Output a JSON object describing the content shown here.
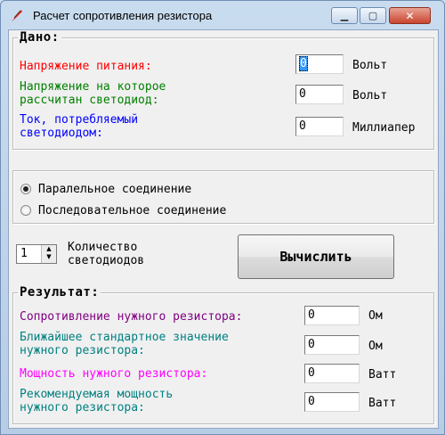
{
  "window": {
    "title": "Расчет сопротивления резистора"
  },
  "given": {
    "legend": "Дано:",
    "rows": [
      {
        "label": "Напряжение питания:",
        "value": "0",
        "unit": "Вольт"
      },
      {
        "label": "Напряжение на которое\nрассчитан светодиод:",
        "value": "0",
        "unit": "Вольт"
      },
      {
        "label": "Ток, потребляемый\nсветодиодом:",
        "value": "0",
        "unit": "Миллиапер"
      }
    ]
  },
  "connection": {
    "parallel_label": "Паралельное соединение",
    "serial_label": "Последовательное соединение",
    "selected": "parallel"
  },
  "count": {
    "value": "1",
    "label": "Количество\nсветодиодов"
  },
  "calculate_label": "Вычислить",
  "result": {
    "legend": "Результат:",
    "rows": [
      {
        "label": "Сопротивление нужного резистора:",
        "value": "0",
        "unit": "Ом"
      },
      {
        "label": "Ближайшее стандартное значение\nнужного резистора:",
        "value": "0",
        "unit": "Ом"
      },
      {
        "label": "Мощность нужного резистора:",
        "value": "0",
        "unit": "Ватт"
      },
      {
        "label": "Рекомендуемая мощность\nнужного резистора:",
        "value": "0",
        "unit": "Ватт"
      }
    ]
  },
  "colors": {
    "supply_voltage": "#ff0000",
    "led_voltage": "#008000",
    "led_current": "#0000ff",
    "resistance": "#800080",
    "standard_value": "#008080",
    "power": "#ff00ff",
    "recommended_power": "#008080"
  }
}
